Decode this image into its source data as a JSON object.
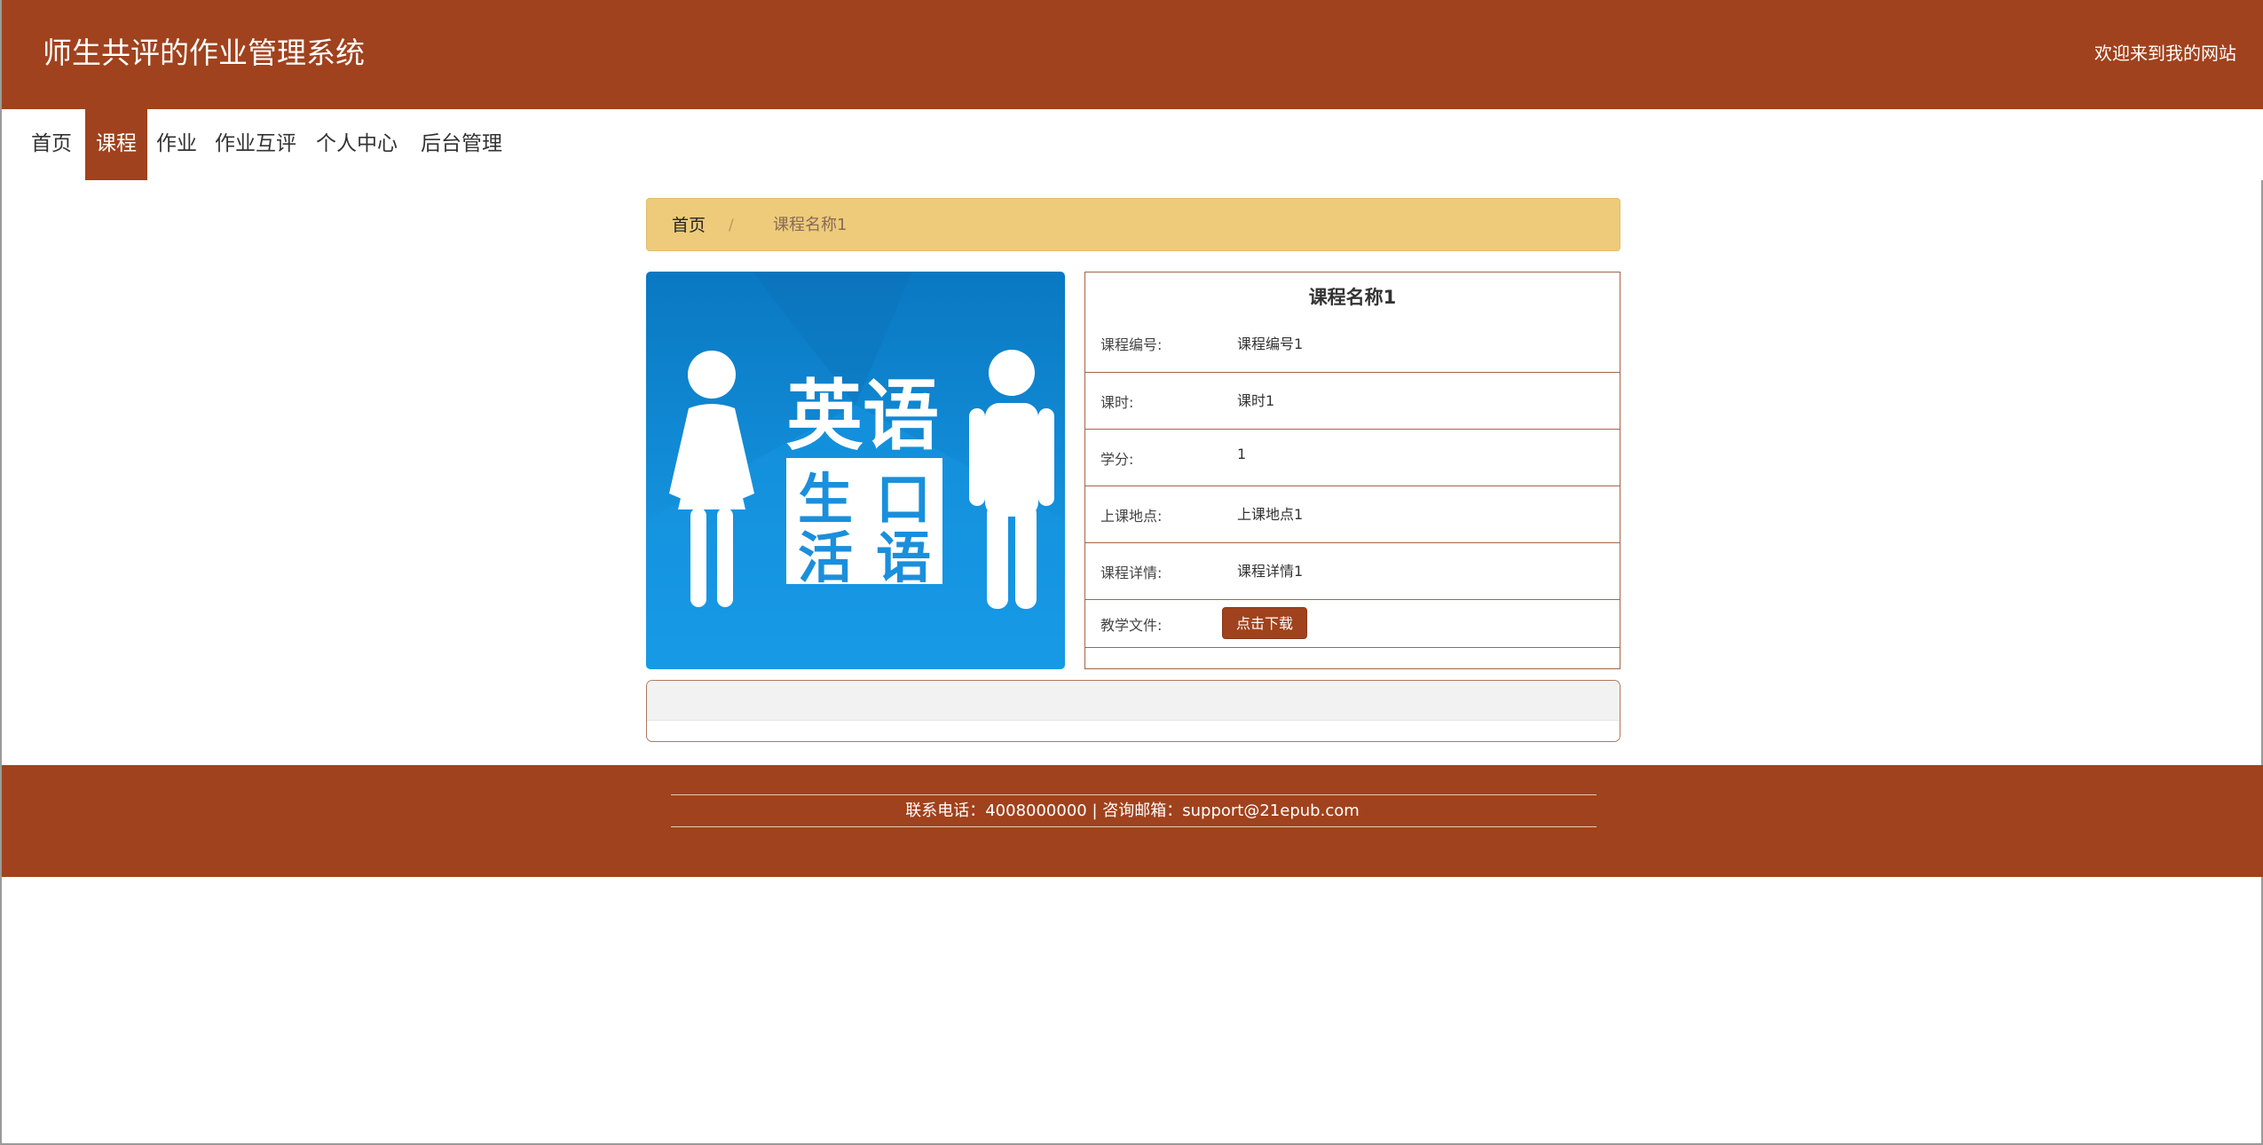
{
  "header": {
    "site_title": "师生共评的作业管理系统",
    "welcome": "欢迎来到我的网站",
    "background_color": "#a0421d"
  },
  "nav": {
    "items": [
      {
        "label": "首页",
        "active": false
      },
      {
        "label": "课程",
        "active": true
      },
      {
        "label": "作业",
        "active": false
      },
      {
        "label": "作业互评",
        "active": false
      },
      {
        "label": "个人中心",
        "active": false
      },
      {
        "label": "后台管理",
        "active": false
      }
    ],
    "active_color": "#a0421d"
  },
  "breadcrumb": {
    "home": "首页",
    "separator": "/",
    "current": "课程名称1",
    "background_color": "#edcb7b"
  },
  "course_image": {
    "text_top": "英语",
    "text_bottom": [
      "生",
      "口",
      "活",
      "语"
    ],
    "icons": [
      "woman-figure-icon",
      "man-figure-icon"
    ],
    "background_color": "#1a8fdc"
  },
  "course": {
    "name": "课程名称1",
    "rows": [
      {
        "label": "课程编号:",
        "value": "课程编号1"
      },
      {
        "label": "课时:",
        "value": "课时1"
      },
      {
        "label": "学分:",
        "value": "1"
      },
      {
        "label": "上课地点:",
        "value": "上课地点1"
      },
      {
        "label": "课程详情:",
        "value": "课程详情1"
      }
    ],
    "file_row": {
      "label": "教学文件:",
      "button_label": "点击下载"
    }
  },
  "footer": {
    "contact": "联系电话：4008000000 | 咨询邮箱：support@21epub.com",
    "background_color": "#a0421d"
  }
}
